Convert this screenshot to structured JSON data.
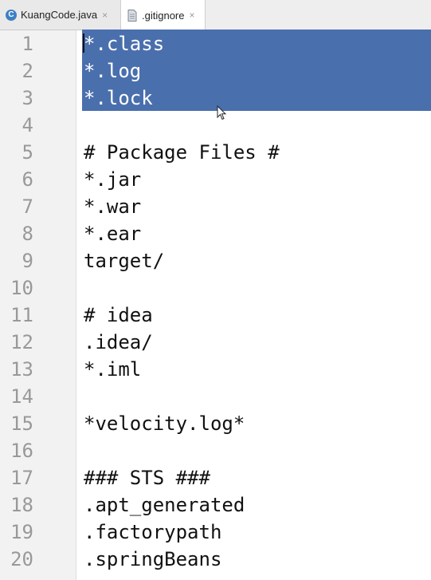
{
  "tabs": [
    {
      "label": "KuangCode.java",
      "icon": "java-class-icon",
      "close": "×"
    },
    {
      "label": ".gitignore",
      "icon": "file-icon",
      "close": "×",
      "active": true
    }
  ],
  "editor": {
    "selection_color": "#4a6fad",
    "lines": [
      {
        "n": "1",
        "text": "*.class",
        "selected": true
      },
      {
        "n": "2",
        "text": "*.log",
        "selected": true
      },
      {
        "n": "3",
        "text": "*.lock",
        "selected": true
      },
      {
        "n": "4",
        "text": ""
      },
      {
        "n": "5",
        "text": "# Package Files #"
      },
      {
        "n": "6",
        "text": "*.jar"
      },
      {
        "n": "7",
        "text": "*.war"
      },
      {
        "n": "8",
        "text": "*.ear"
      },
      {
        "n": "9",
        "text": "target/"
      },
      {
        "n": "10",
        "text": ""
      },
      {
        "n": "11",
        "text": "# idea"
      },
      {
        "n": "12",
        "text": ".idea/"
      },
      {
        "n": "13",
        "text": "*.iml"
      },
      {
        "n": "14",
        "text": ""
      },
      {
        "n": "15",
        "text": "*velocity.log*"
      },
      {
        "n": "16",
        "text": ""
      },
      {
        "n": "17",
        "text": "### STS ###"
      },
      {
        "n": "18",
        "text": ".apt_generated"
      },
      {
        "n": "19",
        "text": ".factorypath"
      },
      {
        "n": "20",
        "text": ".springBeans"
      }
    ]
  }
}
